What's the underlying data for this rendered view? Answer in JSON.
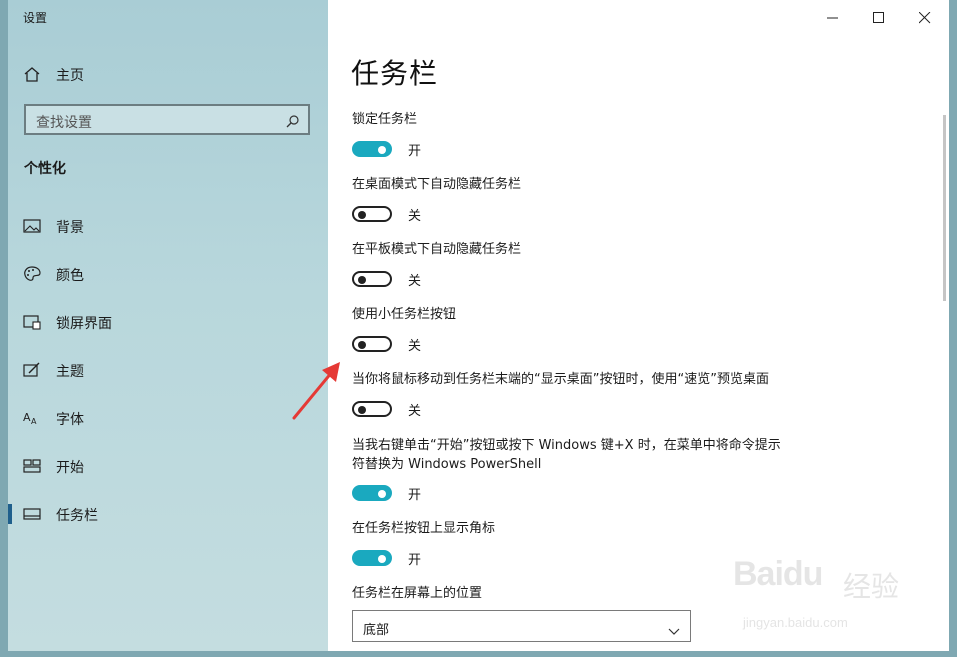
{
  "window": {
    "title": "设置"
  },
  "sidebar": {
    "home_label": "主页",
    "search_placeholder": "查找设置",
    "section_title": "个性化",
    "items": [
      {
        "label": "背景",
        "icon": "image-icon"
      },
      {
        "label": "颜色",
        "icon": "palette-icon"
      },
      {
        "label": "锁屏界面",
        "icon": "lock-screen-icon"
      },
      {
        "label": "主题",
        "icon": "theme-icon"
      },
      {
        "label": "字体",
        "icon": "font-icon"
      },
      {
        "label": "开始",
        "icon": "start-icon"
      },
      {
        "label": "任务栏",
        "icon": "taskbar-icon",
        "active": true
      }
    ]
  },
  "main": {
    "title": "任务栏",
    "settings": [
      {
        "label": "锁定任务栏",
        "state": "开",
        "on": true
      },
      {
        "label": "在桌面模式下自动隐藏任务栏",
        "state": "关",
        "on": false
      },
      {
        "label": "在平板模式下自动隐藏任务栏",
        "state": "关",
        "on": false
      },
      {
        "label": "使用小任务栏按钮",
        "state": "关",
        "on": false
      },
      {
        "label": "当你将鼠标移动到任务栏末端的“显示桌面”按钮时，使用“速览”预览桌面",
        "state": "关",
        "on": false
      },
      {
        "label": "当我右键单击“开始”按钮或按下 Windows 键+X 时，在菜单中将命令提示符替换为 Windows PowerShell",
        "state": "开",
        "on": true
      },
      {
        "label": "在任务栏按钮上显示角标",
        "state": "开",
        "on": true
      }
    ],
    "position_label": "任务栏在屏幕上的位置",
    "position_value": "底部"
  },
  "watermark": {
    "logo": "Baidu",
    "text": "经验",
    "url": "jingyan.baidu.com"
  },
  "colors": {
    "accent": "#1aa9bf",
    "sidebar": "#b8d7dc",
    "arrow": "#e53935"
  }
}
